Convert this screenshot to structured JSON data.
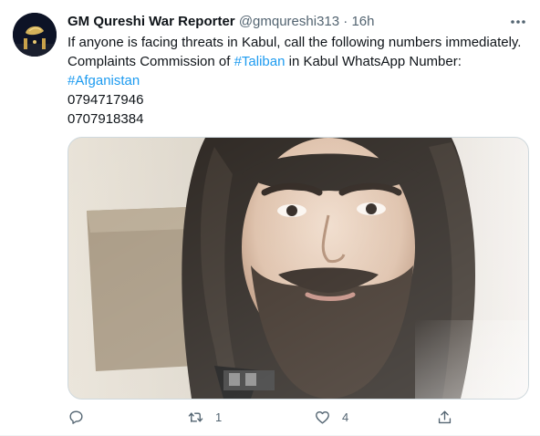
{
  "author": {
    "name": "GM Qureshi War Reporter",
    "handle": "@gmqureshi313",
    "separator": "·",
    "time": "16h"
  },
  "tweet": {
    "line1": "If anyone is facing threats in Kabul, call the following numbers immediately.",
    "line2_prefix": " Complaints Commission of ",
    "line2_tag": "#Taliban",
    "line2_suffix": " in Kabul WhatsApp Number:",
    "line3_tag": "#Afganistan",
    "phone1": " 0794717946",
    "phone2": " 0707918384"
  },
  "actions": {
    "replies": "",
    "retweets": "1",
    "likes": "4"
  },
  "icons": {
    "more": "more-dots-icon",
    "reply": "reply-icon",
    "retweet": "retweet-icon",
    "like": "heart-icon",
    "share": "share-icon"
  },
  "colors": {
    "link": "#1d9bf0",
    "secondary_text": "#536471",
    "text": "#0f1419"
  }
}
